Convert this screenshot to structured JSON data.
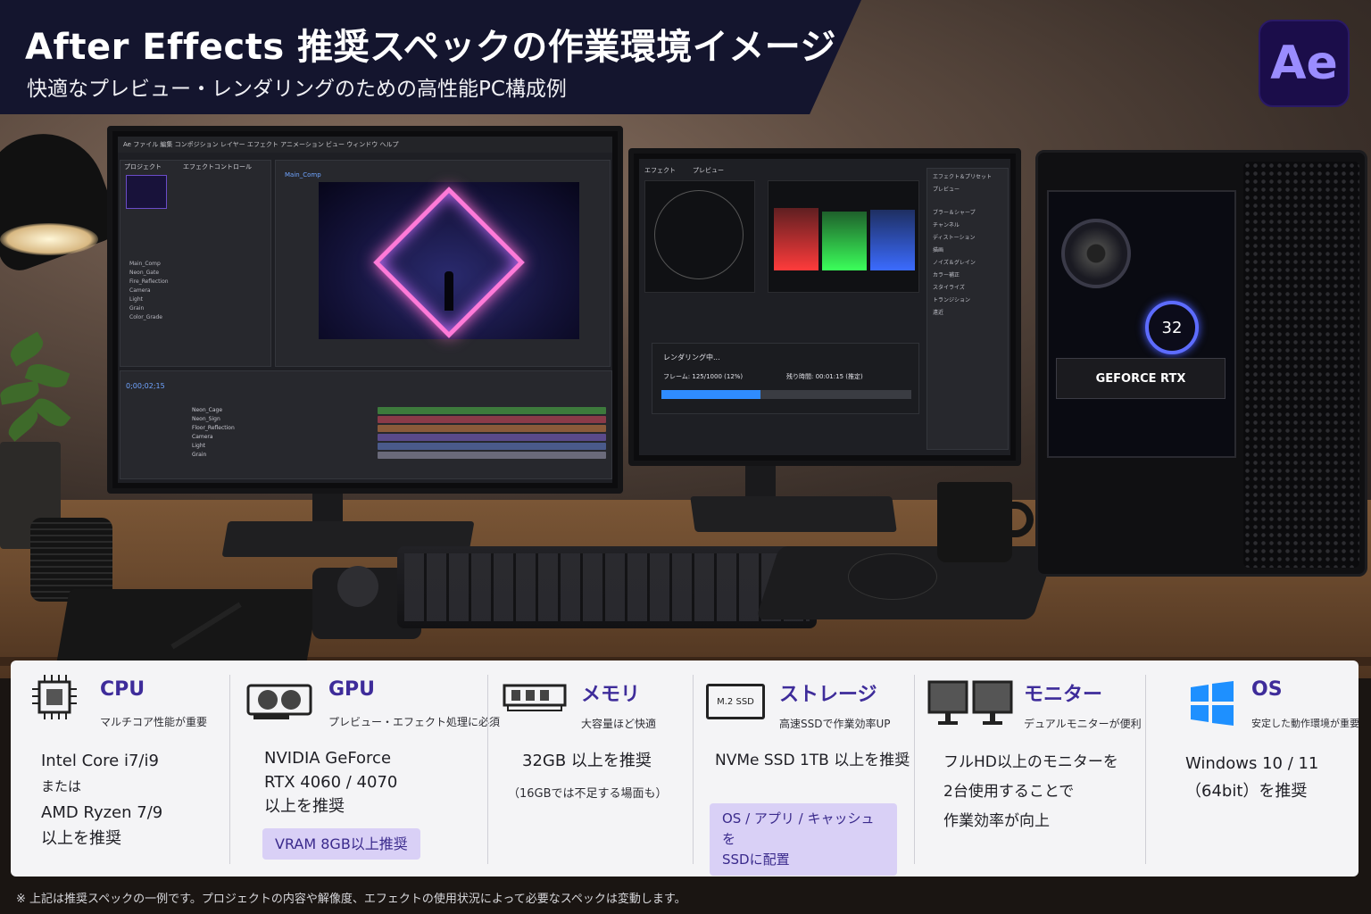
{
  "header": {
    "title": "After Effects 推奨スペックの作業環境イメージ",
    "subtitle": "快適なプレビュー・レンダリングのための高性能PC構成例",
    "logo_text": "Ae"
  },
  "scene": {
    "left_monitor": {
      "menu": "Ae  ファイル  編集  コンポジション  レイヤー  エフェクト  アニメーション  ビュー  ウィンドウ  ヘルプ",
      "project_tab": "プロジェクト",
      "effects_tab": "エフェクトコントロール",
      "comp_tab": "Main_Comp",
      "project_items": [
        "Main_Comp",
        "Neon_Gate",
        "Fire_Reflection",
        "Camera",
        "Light",
        "Grain",
        "Color_Grade"
      ],
      "timecode": "0;00;02;15",
      "layers": [
        "Neon_Cage",
        "Neon_Sign",
        "Floor_Reflection",
        "Camera",
        "Light",
        "Grain"
      ]
    },
    "right_monitor": {
      "tab_effects": "エフェクト",
      "tab_preview": "プレビュー",
      "render_title": "レンダリング中...",
      "render_frame": "フレーム: 125/1000 (12%)",
      "render_remaining": "残り時間: 00:01:15 (推定)",
      "render_progress": 0.12,
      "side_panel": [
        "エフェクト＆プリセット",
        "プレビュー",
        "ブラー＆シャープ",
        "チャンネル",
        "ディストーション",
        "描画",
        "ノイズ＆グレイン",
        "カラー補正",
        "スタイライズ",
        "トランジション",
        "遠近"
      ]
    },
    "tower": {
      "gpu_label": "GEFORCE RTX",
      "pump_display": "32"
    }
  },
  "specs": [
    {
      "key": "cpu",
      "title": "CPU",
      "sub": "マルチコア性能が重要",
      "body": [
        "Intel Core i7/i9",
        "または",
        "AMD Ryzen 7/9",
        "以上を推奨"
      ],
      "icon": "cpu-icon"
    },
    {
      "key": "gpu",
      "title": "GPU",
      "sub": "プレビュー・エフェクト処理に必須",
      "body": [
        "NVIDIA GeForce",
        "RTX 4060 / 4070",
        "以上を推奨"
      ],
      "badge": "VRAM 8GB以上推奨",
      "icon": "graphics-card-icon"
    },
    {
      "key": "memory",
      "title": "メモリ",
      "sub": "大容量ほど快適",
      "body": [
        "32GB 以上を推奨"
      ],
      "note": "（16GBでは不足する場面も）",
      "icon": "ram-icon"
    },
    {
      "key": "storage",
      "title": "ストレージ",
      "sub": "高速SSDで作業効率UP",
      "body": [
        "NVMe SSD 1TB 以上を推奨"
      ],
      "badge_lines": [
        "OS / アプリ / キャッシュを",
        "SSDに配置"
      ],
      "icon": "ssd-icon",
      "icon_text": "M.2 SSD"
    },
    {
      "key": "monitor",
      "title": "モニター",
      "sub": "デュアルモニターが便利",
      "body": [
        "フルHD以上のモニターを",
        "2台使用することで",
        "作業効率が向上"
      ],
      "icon": "dual-monitor-icon"
    },
    {
      "key": "os",
      "title": "OS",
      "sub": "安定した動作環境が重要",
      "body": [
        "Windows 10 / 11",
        "（64bit）を推奨"
      ],
      "icon": "windows-icon"
    }
  ],
  "footer": "※ 上記は推奨スペックの一例です。プロジェクトの内容や解像度、エフェクトの使用状況によって必要なスペックは変動します。",
  "colors": {
    "accent": "#3e2c9a",
    "badge_bg": "#d9d0f6",
    "header_bg": "#14152e",
    "progress": "#2f8cff",
    "ae_logo_bg": "#1b0d4a",
    "ae_logo_fg": "#9a8cff"
  }
}
